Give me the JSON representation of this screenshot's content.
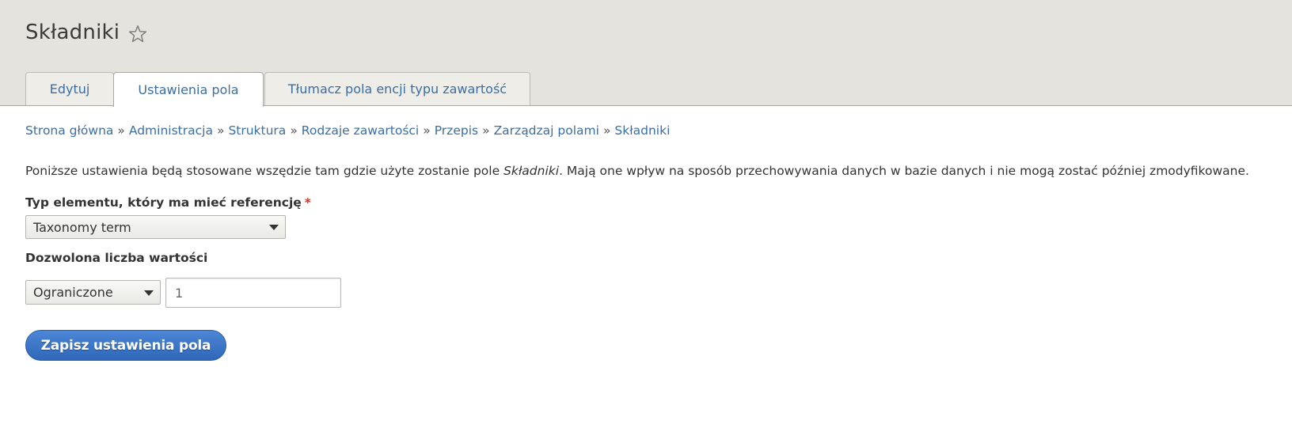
{
  "header": {
    "title": "Składniki",
    "tabs": [
      {
        "label": "Edytuj",
        "active": false
      },
      {
        "label": "Ustawienia pola",
        "active": true
      },
      {
        "label": "Tłumacz pola encji typu zawartość",
        "active": false
      }
    ]
  },
  "breadcrumb": [
    "Strona główna",
    "Administracja",
    "Struktura",
    "Rodzaje zawartości",
    "Przepis",
    "Zarządzaj polami",
    "Składniki"
  ],
  "breadcrumb_separator": "»",
  "description": {
    "before": "Poniższe ustawienia będą stosowane wszędzie tam gdzie użyte zostanie pole ",
    "field": "Składniki",
    "after": ". Mają one wpływ na sposób przechowywania danych w bazie danych i nie mogą zostać później zmodyfikowane."
  },
  "form": {
    "target_type_label": "Typ elementu, który ma mieć referencję",
    "required_marker": "*",
    "target_type_value": "Taxonomy term",
    "cardinality_label": "Dozwolona liczba wartości",
    "cardinality_value": "Ograniczone",
    "cardinality_number": "1",
    "save_label": "Zapisz ustawienia pola"
  },
  "colors": {
    "header_bg": "#e4e3dd",
    "link": "#3a6ea5",
    "button": "#3b74c5",
    "required": "#c0392b"
  },
  "icons": {
    "favorite": "star-outline-icon",
    "dropdown": "caret-down-icon"
  }
}
